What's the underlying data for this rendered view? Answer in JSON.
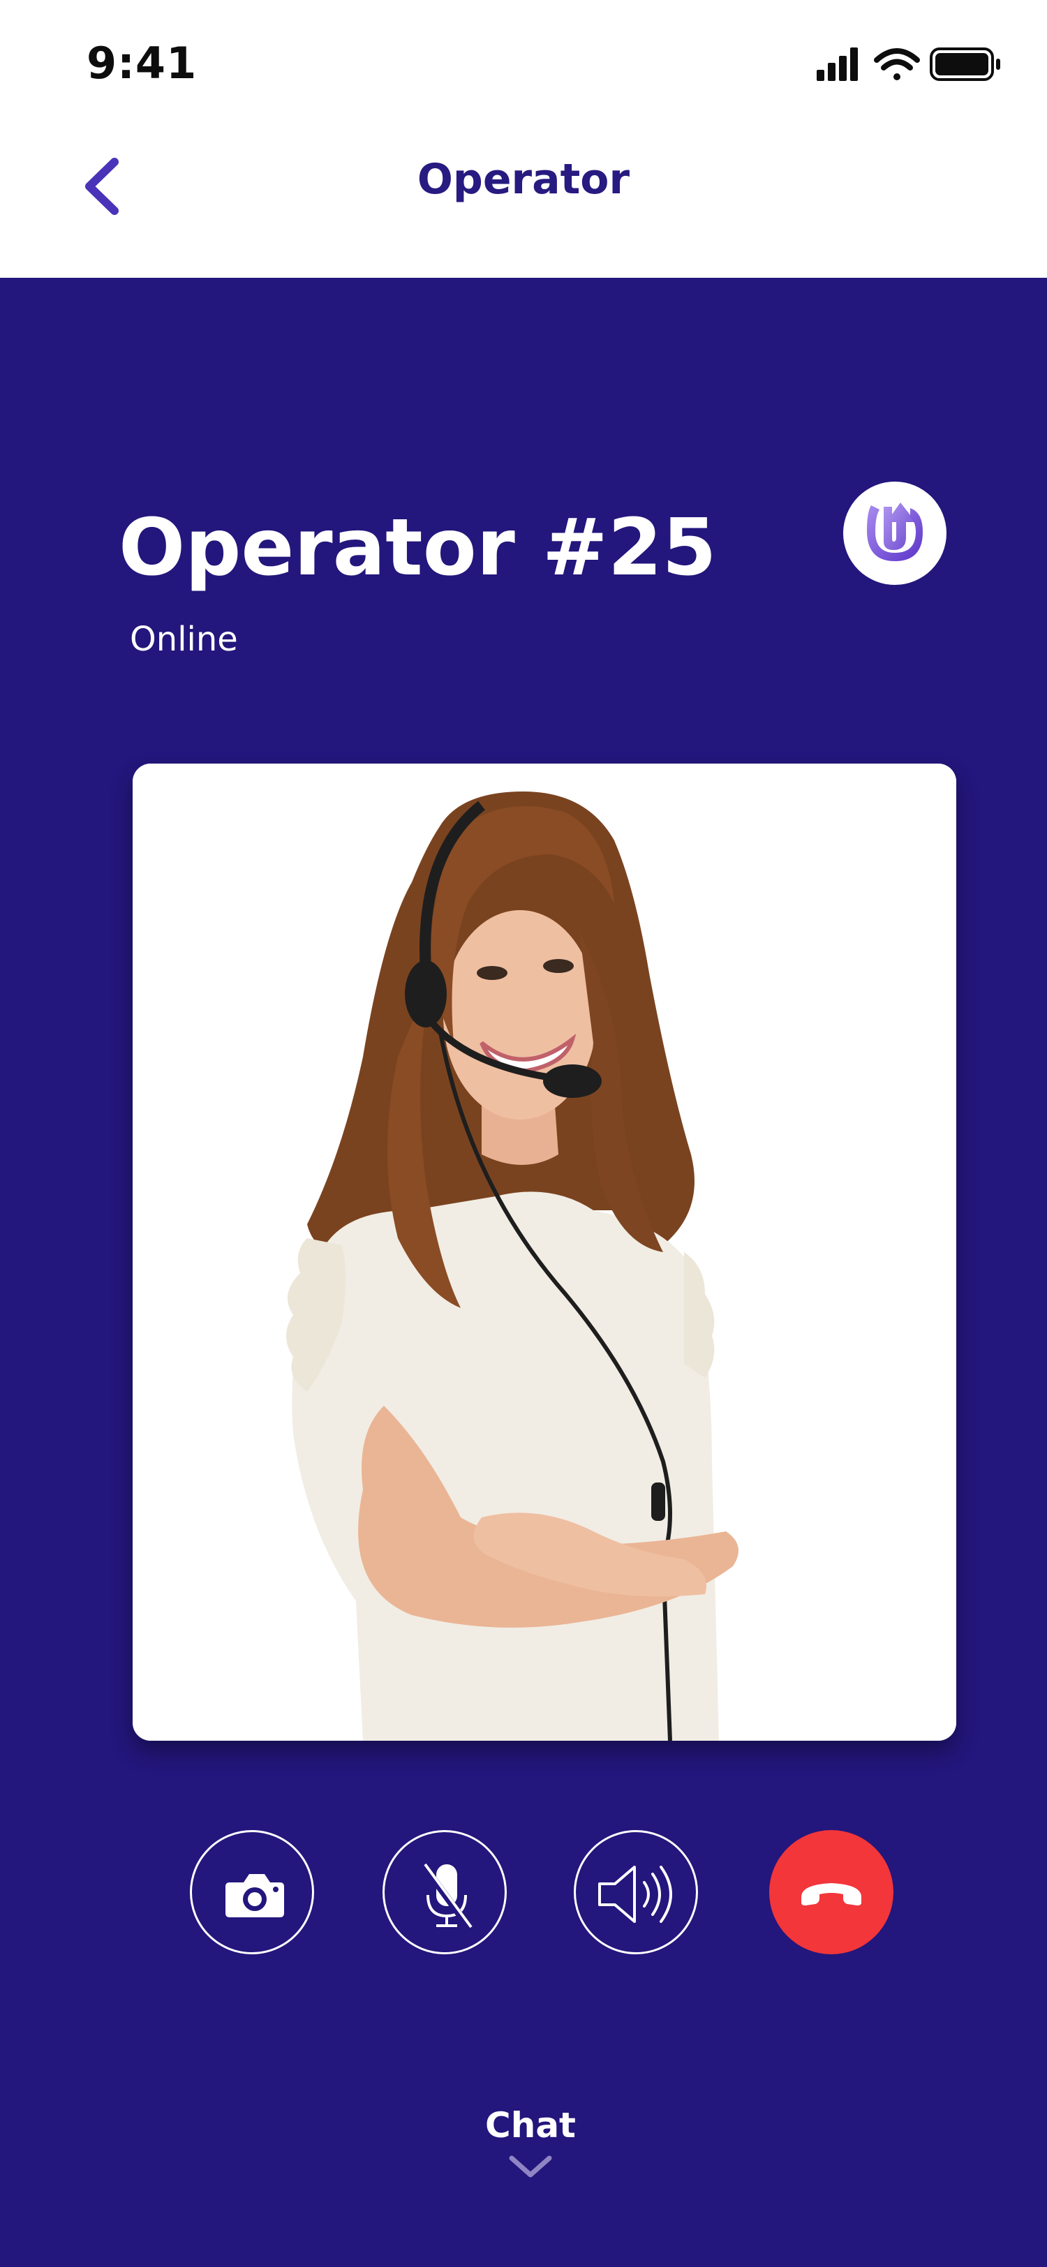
{
  "status_bar": {
    "time": "9:41",
    "icons": [
      "signal-icon",
      "wifi-icon",
      "battery-icon"
    ]
  },
  "nav": {
    "title": "Operator",
    "back_icon": "chevron-left-icon"
  },
  "operator": {
    "name": "Operator #25",
    "status": "Online",
    "logo": "brand-logo"
  },
  "controls": [
    {
      "name": "camera",
      "icon": "camera-icon"
    },
    {
      "name": "mute",
      "icon": "microphone-muted-icon"
    },
    {
      "name": "speaker",
      "icon": "speaker-icon"
    },
    {
      "name": "end-call",
      "icon": "phone-hangup-icon"
    }
  ],
  "chat": {
    "label": "Chat",
    "icon": "chevron-down-icon"
  },
  "colors": {
    "background": "#23167c",
    "accent": "#271a80",
    "back_arrow": "#4a33b8",
    "end_call": "#f2363a",
    "logo_gradient_start": "#8a6fe0",
    "logo_gradient_end": "#5a33c8"
  }
}
